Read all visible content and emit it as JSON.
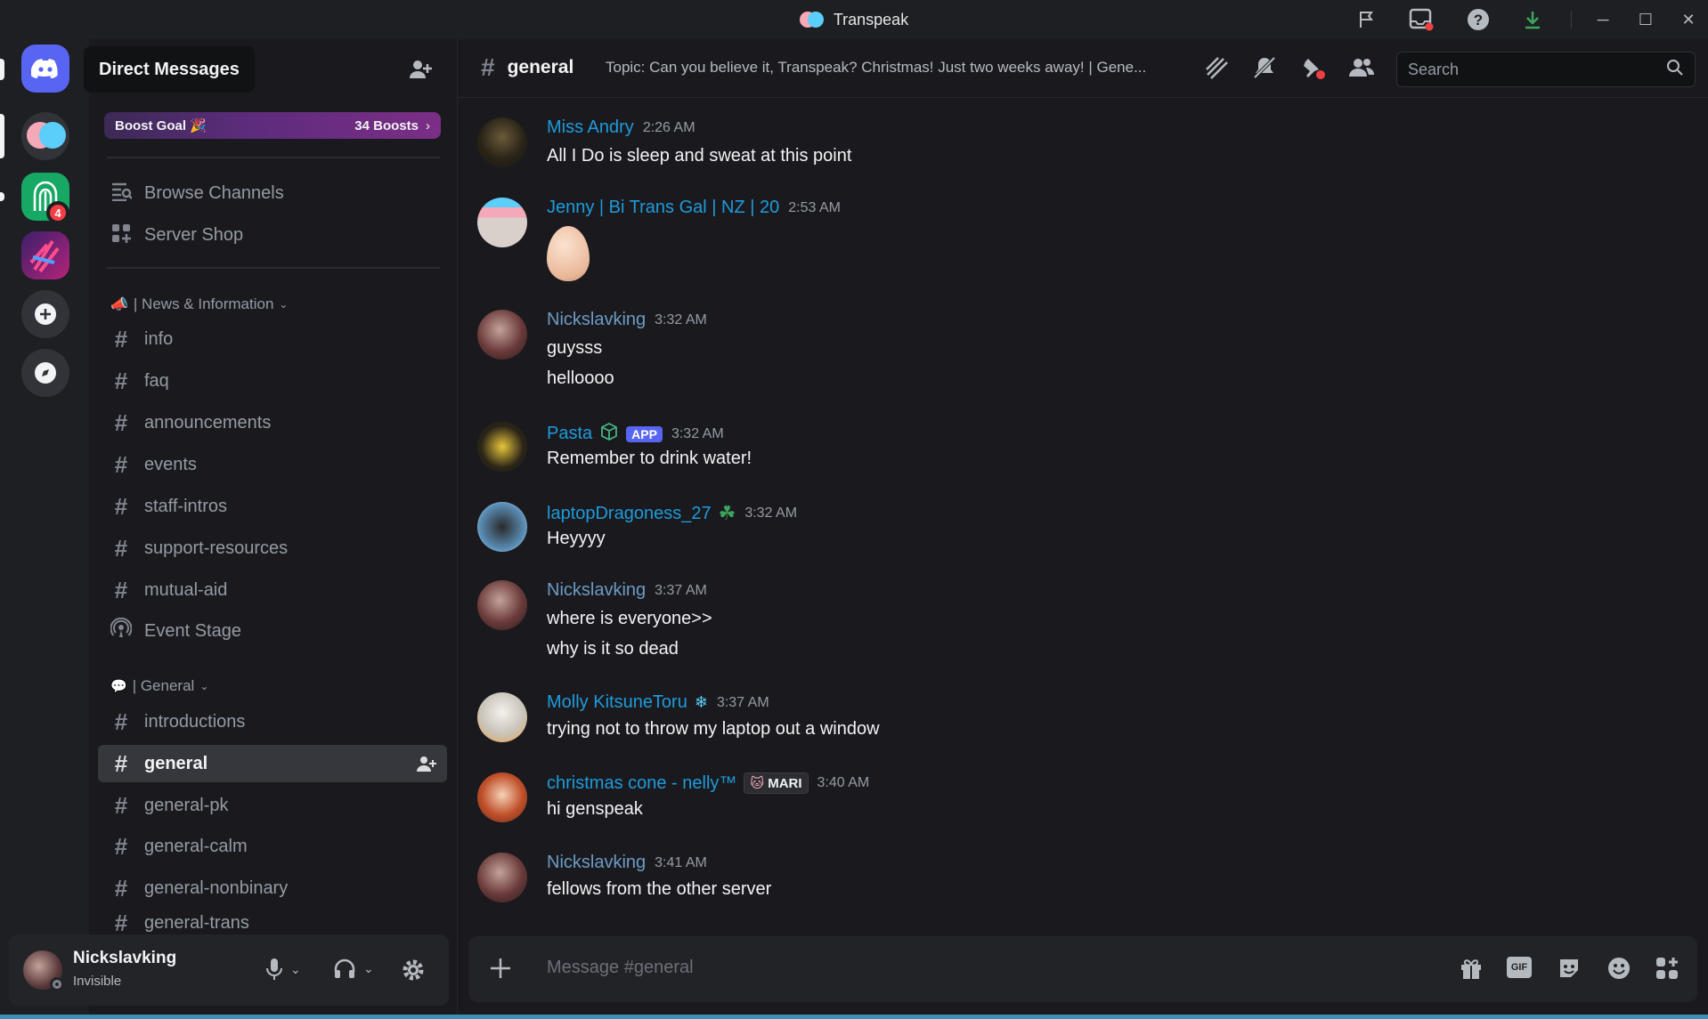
{
  "window": {
    "title": "Transpeak"
  },
  "titlebar_icons": [
    "flag-icon",
    "inbox-icon",
    "help-icon",
    "download-icon"
  ],
  "servers": {
    "dm_tooltip": "Direct Messages",
    "badge_count": "4"
  },
  "sidebar": {
    "boost_goal_label": "Boost Goal 🎉",
    "boost_count": "34 Boosts",
    "browse_channels": "Browse Channels",
    "server_shop": "Server Shop",
    "category_news": "| News & Information",
    "news_channels": [
      "info",
      "faq",
      "announcements",
      "events",
      "staff-intros",
      "support-resources",
      "mutual-aid"
    ],
    "event_stage": "Event Stage",
    "category_general": "| General",
    "general_channels": [
      "introductions",
      "general",
      "general-pk",
      "general-calm",
      "general-nonbinary",
      "general-trans"
    ],
    "active_channel": "general"
  },
  "user_panel": {
    "username": "Nickslavking",
    "status": "Invisible"
  },
  "header": {
    "channel_name": "general",
    "topic": "Topic: Can you believe it, Transpeak? Christmas! Just two weeks away! | Gene...",
    "search_placeholder": "Search"
  },
  "messages": [
    {
      "author": "Miss Andry",
      "time": "2:26 AM",
      "lines": [
        "All I Do is sleep and sweat at this point"
      ]
    },
    {
      "author": "Jenny | Bi Trans Gal | NZ | 20",
      "time": "2:53 AM",
      "lines": []
    },
    {
      "author": "Nickslavking",
      "time": "3:32 AM",
      "lines": [
        "guysss",
        "helloooo"
      ]
    },
    {
      "author": "Pasta",
      "badge": "APP",
      "time": "3:32 AM",
      "lines": [
        "Remember to drink water!"
      ]
    },
    {
      "author": "laptopDragoness_27",
      "time": "3:32 AM",
      "lines": [
        "Heyyyy"
      ]
    },
    {
      "author": "Nickslavking",
      "time": "3:37 AM",
      "lines": [
        "where is everyone>>",
        "why is it so dead"
      ]
    },
    {
      "author": "Molly KitsuneToru",
      "time": "3:37 AM",
      "lines": [
        "trying not to throw my laptop out a window"
      ]
    },
    {
      "author": "christmas cone - nelly™",
      "badge": "MARI",
      "time": "3:40 AM",
      "lines": [
        "hi genspeak"
      ]
    },
    {
      "author": "Nickslavking",
      "time": "3:41 AM",
      "lines": [
        "fellows from the other server"
      ]
    }
  ],
  "composer": {
    "placeholder": "Message #general"
  },
  "colors": {
    "username_blue": "#1e9bdc",
    "app_badge": "#5865f2",
    "notification_red": "#f23f43"
  }
}
